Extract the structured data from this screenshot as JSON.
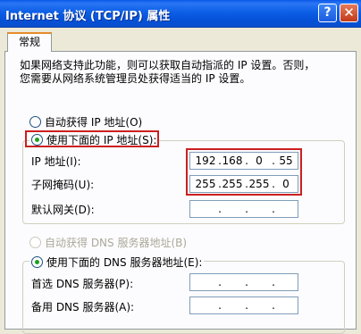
{
  "window": {
    "title": "Internet 协议 (TCP/IP) 属性",
    "help_label": "?",
    "close_label": "✕"
  },
  "tab": {
    "label": "常规"
  },
  "intro_text": "如果网络支持此功能，则可以获取自动指派的 IP 设置。否则，\n您需要从网络系统管理员处获得适当的 IP 设置。",
  "ip_section": {
    "auto_ip_label": "自动获得 IP 地址(O)",
    "manual_ip_label": "使用下面的 IP 地址(S):",
    "selected": "manual",
    "fields": [
      {
        "label": "IP 地址(I):",
        "segments": [
          "192",
          "168",
          "0",
          "55"
        ]
      },
      {
        "label": "子网掩码(U):",
        "segments": [
          "255",
          "255",
          "255",
          "0"
        ]
      },
      {
        "label": "默认网关(D):",
        "segments": [
          "",
          "",
          "",
          ""
        ]
      }
    ]
  },
  "dns_section": {
    "auto_dns_label": "自动获得 DNS 服务器地址(B)",
    "manual_dns_label": "使用下面的 DNS 服务器地址(E):",
    "selected": "manual",
    "fields": [
      {
        "label": "首选 DNS 服务器(P):",
        "segments": [
          "",
          "",
          "",
          ""
        ]
      },
      {
        "label": "备用 DNS 服务器(A):",
        "segments": [
          "",
          "",
          "",
          ""
        ]
      }
    ]
  },
  "colors": {
    "highlight": "#cc1f1f",
    "title_bar": "#0a57e8",
    "dialog_bg": "#ece9d8"
  }
}
